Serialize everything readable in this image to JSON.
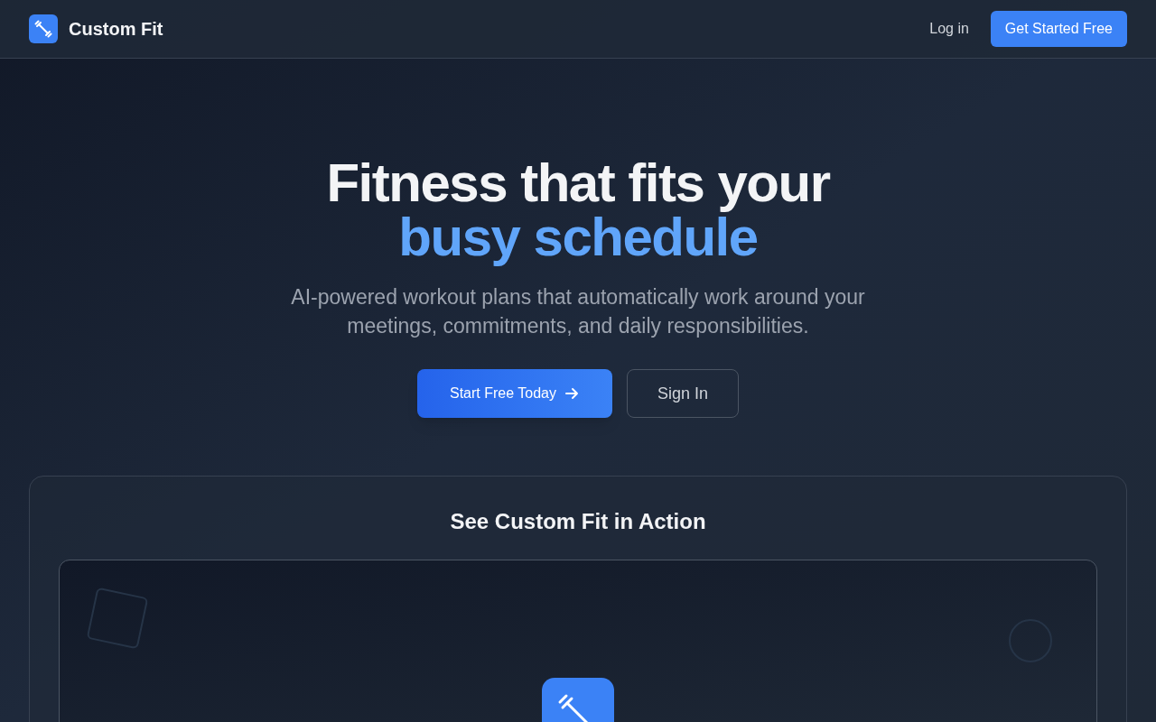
{
  "header": {
    "brand": "Custom Fit",
    "links": [
      {
        "label": "Log in",
        "kind": "link"
      },
      {
        "label": "Get Started Free",
        "kind": "primary"
      }
    ]
  },
  "hero": {
    "title": "Fitness that fits your",
    "title_highlight": "busy schedule",
    "subtitle": "AI-powered workout plans that automatically work around your meetings, commitments, and daily responsibilities.",
    "buttons": [
      {
        "label": "Start Free Today",
        "kind": "primary"
      },
      {
        "label": "Sign In",
        "kind": "outline"
      }
    ]
  },
  "demo": {
    "title": "See Custom Fit in Action"
  }
}
